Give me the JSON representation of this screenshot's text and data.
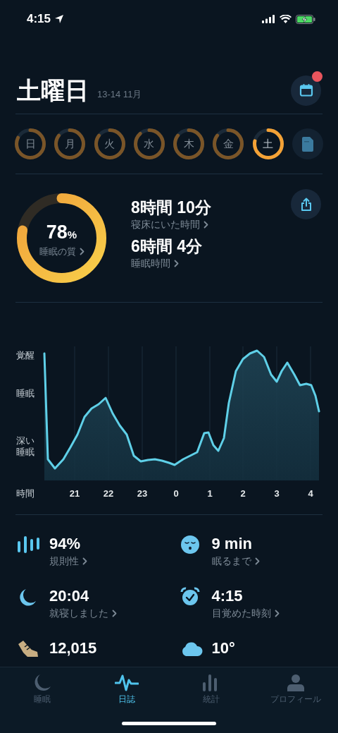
{
  "status_bar": {
    "time": "4:15"
  },
  "header": {
    "title": "土曜日",
    "date": "13-14 11月",
    "calendar_badge": true
  },
  "days": [
    {
      "label": "日",
      "level": 0.82,
      "selected": false
    },
    {
      "label": "月",
      "level": 0.85,
      "selected": false
    },
    {
      "label": "火",
      "level": 0.85,
      "selected": false
    },
    {
      "label": "水",
      "level": 0.88,
      "selected": false
    },
    {
      "label": "木",
      "level": 0.85,
      "selected": false
    },
    {
      "label": "金",
      "level": 0.85,
      "selected": false
    },
    {
      "label": "土",
      "level": 0.78,
      "selected": true
    }
  ],
  "summary": {
    "quality": {
      "value": "78",
      "unit": "%",
      "label": "睡眠の質",
      "level": 0.78
    },
    "stats": [
      {
        "value": "8時間 10分",
        "label": "寝床にいた時間"
      },
      {
        "value": "6時間 4分",
        "label": "睡眠時間"
      }
    ]
  },
  "chart": {
    "y_labels": [
      "覚醒",
      "睡眠",
      "深い睡眠"
    ],
    "x_title": "時間",
    "x_labels": [
      "21",
      "22",
      "23",
      "0",
      "1",
      "2",
      "3",
      "4"
    ]
  },
  "metrics": [
    {
      "value": "94%",
      "label": "規則性"
    },
    {
      "value": "9 min",
      "label": "眠るまで"
    },
    {
      "value": "20:04",
      "label": "就寝しました"
    },
    {
      "value": "4:15",
      "label": "目覚めた時刻"
    },
    {
      "value": "12,015"
    },
    {
      "value": "10°"
    }
  ],
  "tabs": [
    {
      "label": "睡眠",
      "selected": false
    },
    {
      "label": "日誌",
      "selected": true
    },
    {
      "label": "統計",
      "selected": false
    },
    {
      "label": "プロフィール",
      "selected": false
    }
  ]
}
